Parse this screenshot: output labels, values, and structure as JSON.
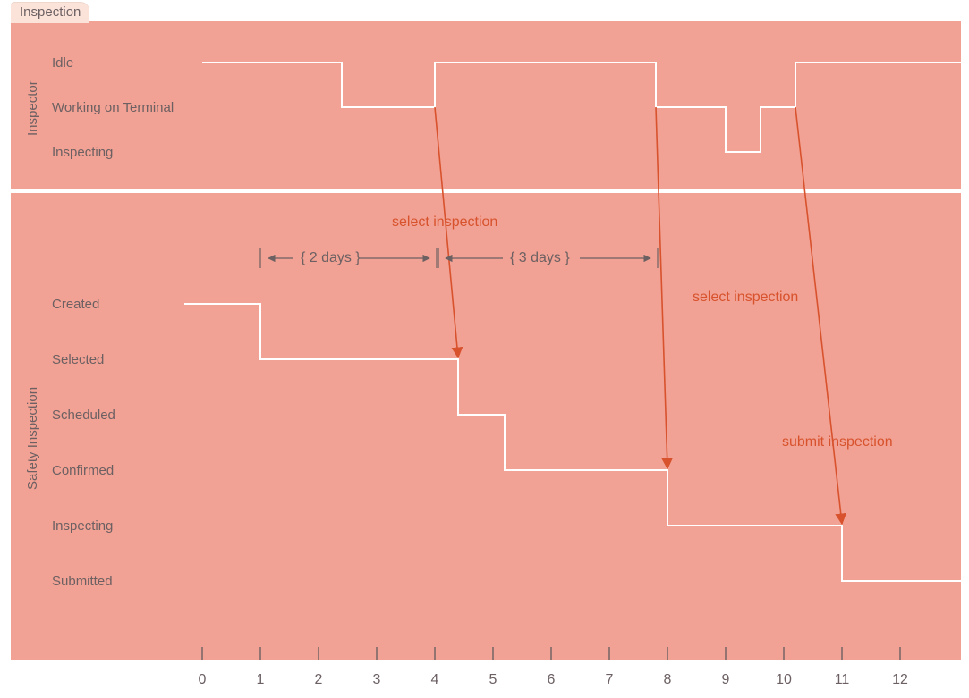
{
  "tab_title": "Inspection",
  "lanes": {
    "inspector": {
      "title": "Inspector",
      "rows": [
        "Idle",
        "Working on Terminal",
        "Inspecting"
      ]
    },
    "safety": {
      "title": "Safety Inspection",
      "rows": [
        "Created",
        "Selected",
        "Scheduled",
        "Confirmed",
        "Inspecting",
        "Submitted"
      ]
    }
  },
  "durations": {
    "d1": "{ 2 days }",
    "d2": "{ 3 days }"
  },
  "annotations": {
    "sel1": "select inspection",
    "sel2": "select inspection",
    "submit": "submit inspection"
  },
  "axis": {
    "ticks": [
      "0",
      "1",
      "2",
      "3",
      "4",
      "5",
      "6",
      "7",
      "8",
      "9",
      "10",
      "11",
      "12"
    ]
  },
  "chart_data": {
    "type": "line",
    "x_axis": {
      "range": [
        0,
        12
      ],
      "unit": "days",
      "ticks": [
        0,
        1,
        2,
        3,
        4,
        5,
        6,
        7,
        8,
        9,
        10,
        11,
        12
      ]
    },
    "lanes": [
      {
        "name": "Inspector",
        "states": [
          "Idle",
          "Working on Terminal",
          "Inspecting"
        ],
        "timeline": [
          {
            "from": 0.0,
            "to": 2.4,
            "state": "Idle"
          },
          {
            "from": 2.4,
            "to": 4.0,
            "state": "Working on Terminal"
          },
          {
            "from": 4.0,
            "to": 7.8,
            "state": "Idle"
          },
          {
            "from": 7.8,
            "to": 9.0,
            "state": "Working on Terminal"
          },
          {
            "from": 9.0,
            "to": 9.6,
            "state": "Inspecting"
          },
          {
            "from": 9.6,
            "to": 10.2,
            "state": "Working on Terminal"
          },
          {
            "from": 10.2,
            "to": 12.0,
            "state": "Idle"
          }
        ]
      },
      {
        "name": "Safety Inspection",
        "states": [
          "Created",
          "Selected",
          "Scheduled",
          "Confirmed",
          "Inspecting",
          "Submitted"
        ],
        "timeline": [
          {
            "from": 0.0,
            "to": 1.0,
            "state": "Created"
          },
          {
            "from": 1.0,
            "to": 4.4,
            "state": "Selected"
          },
          {
            "from": 4.4,
            "to": 5.2,
            "state": "Scheduled"
          },
          {
            "from": 5.2,
            "to": 8.0,
            "state": "Confirmed"
          },
          {
            "from": 8.0,
            "to": 11.0,
            "state": "Inspecting"
          },
          {
            "from": 11.0,
            "to": 12.0,
            "state": "Submitted"
          }
        ]
      }
    ],
    "messages": [
      {
        "label": "select inspection",
        "from_lane": "Inspector",
        "from_state": "Working on Terminal",
        "to_lane": "Safety Inspection",
        "to_state": "Selected",
        "at_x_start": 4.0,
        "at_x_end": 4.4
      },
      {
        "label": "select inspection",
        "from_lane": "Inspector",
        "from_state": "Working on Terminal",
        "to_lane": "Safety Inspection",
        "to_state": "Confirmed",
        "at_x_start": 7.8,
        "at_x_end": 8.0
      },
      {
        "label": "submit inspection",
        "from_lane": "Inspector",
        "from_state": "Working on Terminal",
        "to_lane": "Safety Inspection",
        "to_state": "Inspecting",
        "at_x_start": 10.2,
        "at_x_end": 11.0
      }
    ],
    "durations": [
      {
        "label": "{ 2 days }",
        "from_x": 1.0,
        "to_x": 4.4
      },
      {
        "label": "{ 3 days }",
        "from_x": 4.4,
        "to_x": 7.8
      }
    ]
  },
  "colors": {
    "panel": "#f2a294",
    "tab_bg": "#fbe3d9",
    "state_line": "#ffffff",
    "text": "#6c6062",
    "accent": "#d7522d"
  }
}
